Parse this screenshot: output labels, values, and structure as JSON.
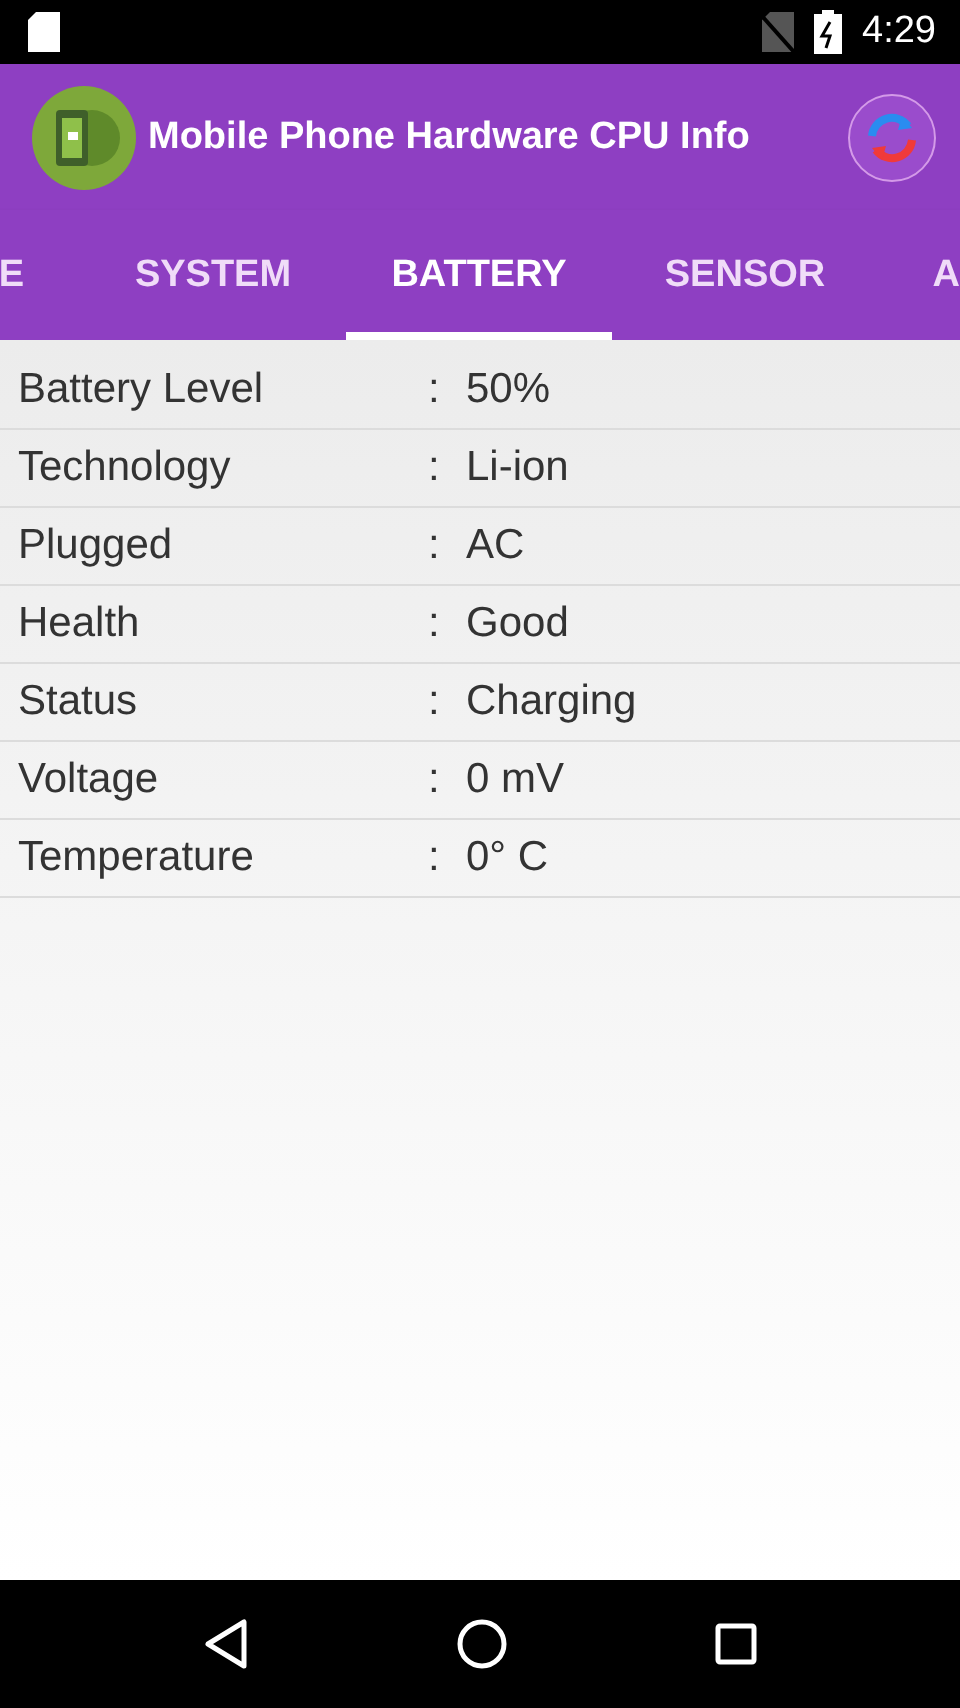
{
  "status_bar": {
    "time": "4:29"
  },
  "app_bar": {
    "title": "Mobile Phone Hardware CPU Info"
  },
  "tabs": [
    {
      "label": "E",
      "selected": false
    },
    {
      "label": "SYSTEM",
      "selected": false
    },
    {
      "label": "BATTERY",
      "selected": true
    },
    {
      "label": "SENSOR",
      "selected": false
    },
    {
      "label": "A",
      "selected": false
    }
  ],
  "rows": [
    {
      "label": "Battery Level",
      "separator": ":",
      "value": "50%"
    },
    {
      "label": "Technology",
      "separator": ":",
      "value": "Li-ion"
    },
    {
      "label": "Plugged",
      "separator": ":",
      "value": "AC"
    },
    {
      "label": "Health",
      "separator": ":",
      "value": "Good"
    },
    {
      "label": "Status",
      "separator": ":",
      "value": "Charging"
    },
    {
      "label": "Voltage",
      "separator": ":",
      "value": "0 mV"
    },
    {
      "label": "Temperature",
      "separator": ":",
      "value": "0° C"
    }
  ]
}
